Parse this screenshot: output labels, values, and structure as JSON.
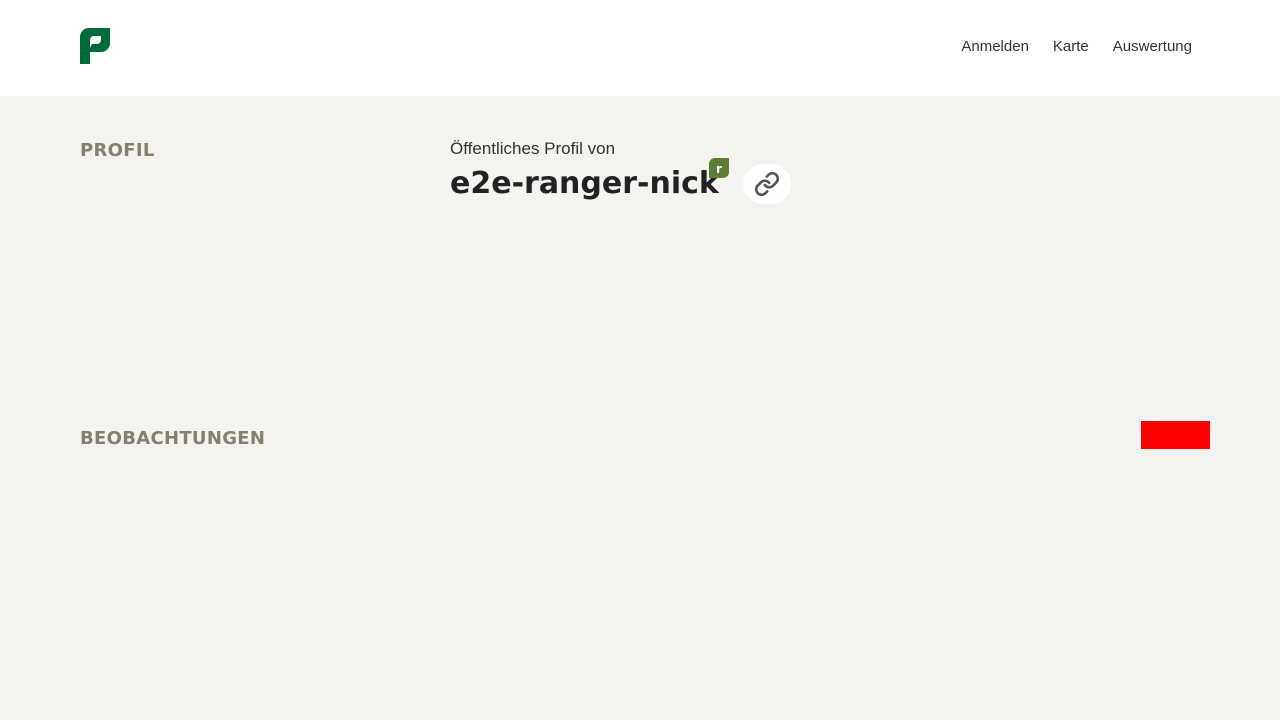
{
  "header": {
    "logo_icon": "parlament-p-logo-icon",
    "brand_color": "#006b3a",
    "nav": [
      {
        "label": "Anmelden"
      },
      {
        "label": "Karte"
      },
      {
        "label": "Auswertung"
      }
    ]
  },
  "profile": {
    "section_title": "PROFIL",
    "subtitle": "Öffentliches Profil von",
    "username": "e2e-ranger-nick",
    "badge_letter": "r",
    "badge_color": "#5d7d35",
    "link_icon": "link-icon"
  },
  "observations": {
    "section_title": "BEOBACHTUNGEN",
    "indicator_color": "#ff0000"
  }
}
